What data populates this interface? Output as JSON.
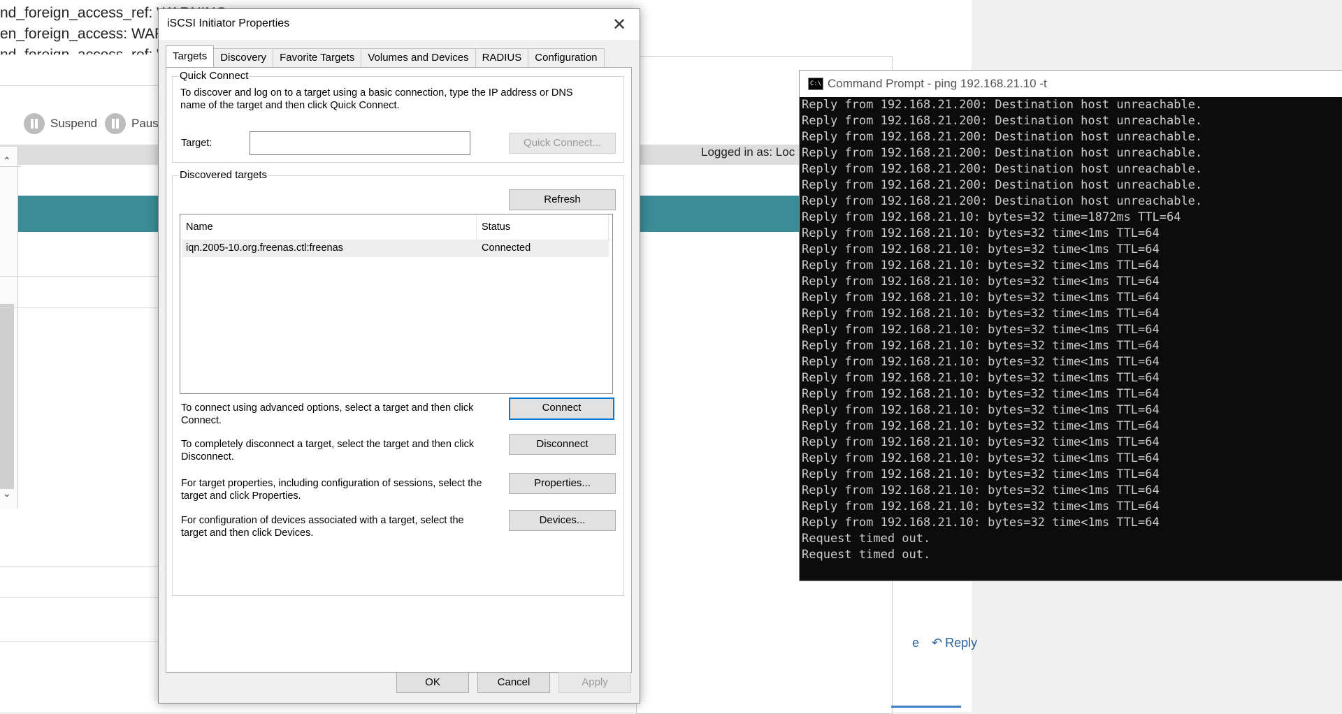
{
  "background": {
    "lines": [
      "nd_foreign_access_ref: WARNING...",
      "en_foreign_access: WARI",
      "nd_foreign_access_ref: W"
    ],
    "toolbar": {
      "suspend": "Suspend",
      "pause": "Paus"
    },
    "logged_in": "Logged in as: Loc",
    "reply": "Reply",
    "reply_prefix": "e"
  },
  "dialog": {
    "title": "iSCSI Initiator Properties",
    "close": "✕",
    "tabs": [
      "Targets",
      "Discovery",
      "Favorite Targets",
      "Volumes and Devices",
      "RADIUS",
      "Configuration"
    ],
    "quick_connect": {
      "legend": "Quick Connect",
      "description": "To discover and log on to a target using a basic connection, type the IP address or DNS name of the target and then click Quick Connect.",
      "target_label": "Target:",
      "target_value": "",
      "button": "Quick Connect..."
    },
    "discovered": {
      "legend": "Discovered targets",
      "refresh": "Refresh",
      "columns": [
        "Name",
        "Status"
      ],
      "rows": [
        {
          "name": "iqn.2005-10.org.freenas.ctl:freenas",
          "status": "Connected"
        }
      ]
    },
    "actions": [
      {
        "text": "To connect using advanced options, select a target and then click Connect.",
        "button": "Connect"
      },
      {
        "text": "To completely disconnect a target, select the target and then click Disconnect.",
        "button": "Disconnect"
      },
      {
        "text": "For target properties, including configuration of sessions, select the target and click Properties.",
        "button": "Properties..."
      },
      {
        "text": "For configuration of devices associated with a target, select the target and then click Devices.",
        "button": "Devices..."
      }
    ],
    "footer": {
      "ok": "OK",
      "cancel": "Cancel",
      "apply": "Apply"
    }
  },
  "cmd": {
    "title": "Command Prompt - ping  192.168.21.10 -t",
    "lines": [
      "Reply from 192.168.21.200: Destination host unreachable.",
      "Reply from 192.168.21.200: Destination host unreachable.",
      "Reply from 192.168.21.200: Destination host unreachable.",
      "Reply from 192.168.21.200: Destination host unreachable.",
      "Reply from 192.168.21.200: Destination host unreachable.",
      "Reply from 192.168.21.200: Destination host unreachable.",
      "Reply from 192.168.21.200: Destination host unreachable.",
      "Reply from 192.168.21.10: bytes=32 time=1872ms TTL=64",
      "Reply from 192.168.21.10: bytes=32 time<1ms TTL=64",
      "Reply from 192.168.21.10: bytes=32 time<1ms TTL=64",
      "Reply from 192.168.21.10: bytes=32 time<1ms TTL=64",
      "Reply from 192.168.21.10: bytes=32 time<1ms TTL=64",
      "Reply from 192.168.21.10: bytes=32 time<1ms TTL=64",
      "Reply from 192.168.21.10: bytes=32 time<1ms TTL=64",
      "Reply from 192.168.21.10: bytes=32 time<1ms TTL=64",
      "Reply from 192.168.21.10: bytes=32 time<1ms TTL=64",
      "Reply from 192.168.21.10: bytes=32 time<1ms TTL=64",
      "Reply from 192.168.21.10: bytes=32 time<1ms TTL=64",
      "Reply from 192.168.21.10: bytes=32 time<1ms TTL=64",
      "Reply from 192.168.21.10: bytes=32 time<1ms TTL=64",
      "Reply from 192.168.21.10: bytes=32 time<1ms TTL=64",
      "Reply from 192.168.21.10: bytes=32 time<1ms TTL=64",
      "Reply from 192.168.21.10: bytes=32 time<1ms TTL=64",
      "Reply from 192.168.21.10: bytes=32 time<1ms TTL=64",
      "Reply from 192.168.21.10: bytes=32 time<1ms TTL=64",
      "Reply from 192.168.21.10: bytes=32 time<1ms TTL=64",
      "Reply from 192.168.21.10: bytes=32 time<1ms TTL=64",
      "Request timed out.",
      "Request timed out."
    ]
  },
  "colors": {
    "accent": "#0078d7",
    "teal": "#3a8d97",
    "console_bg": "#0c0c0c",
    "console_fg": "#cccccc"
  }
}
